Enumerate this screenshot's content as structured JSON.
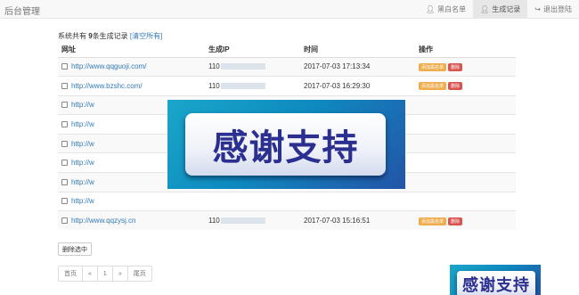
{
  "navbar": {
    "brand": "后台管理",
    "items": [
      {
        "label": "黑白名单",
        "icon": "user-icon",
        "active": false
      },
      {
        "label": "生成记录",
        "icon": "user-icon",
        "active": true
      },
      {
        "label": "退出登陆",
        "icon": "logout-icon",
        "active": false
      }
    ]
  },
  "summary": {
    "prefix": "系统共有",
    "count": "9",
    "suffix": "条生成记录",
    "clear_link": "[清空所有]"
  },
  "table": {
    "headers": [
      "网址",
      "生成IP",
      "时间",
      "操作"
    ],
    "rows": [
      {
        "url": "http://www.qqguoji.com/",
        "ip": "110",
        "time": "2017-07-03 17:13:34",
        "has_actions": true
      },
      {
        "url": "http://www.bzshc.com/",
        "ip": "110",
        "time": "2017-07-03 16:29:30",
        "has_actions": true
      },
      {
        "url": "http://w",
        "ip": "",
        "time": "",
        "has_actions": false
      },
      {
        "url": "http://w",
        "ip": "",
        "time": "",
        "has_actions": false
      },
      {
        "url": "http://w",
        "ip": "",
        "time": "",
        "has_actions": false
      },
      {
        "url": "http://w",
        "ip": "",
        "time": "",
        "has_actions": false
      },
      {
        "url": "http://w",
        "ip": "",
        "time": "",
        "has_actions": false
      },
      {
        "url": "http://w",
        "ip": "",
        "time": "",
        "has_actions": false
      },
      {
        "url": "http://www.qqzysj.cn",
        "ip": "110",
        "time": "2017-07-03 15:16:51",
        "has_actions": true
      }
    ],
    "add_blacklist_label": "添加黑名单",
    "delete_label": "删除"
  },
  "delete_selected_label": "删除选中",
  "pagination": [
    "首页",
    "«",
    "1",
    "»",
    "尾页"
  ],
  "banner_text": "感谢支持",
  "colors": {
    "link": "#337ab7",
    "warning": "#f0ad4e",
    "danger": "#d9534f",
    "banner_text": "#2b2f8f"
  }
}
